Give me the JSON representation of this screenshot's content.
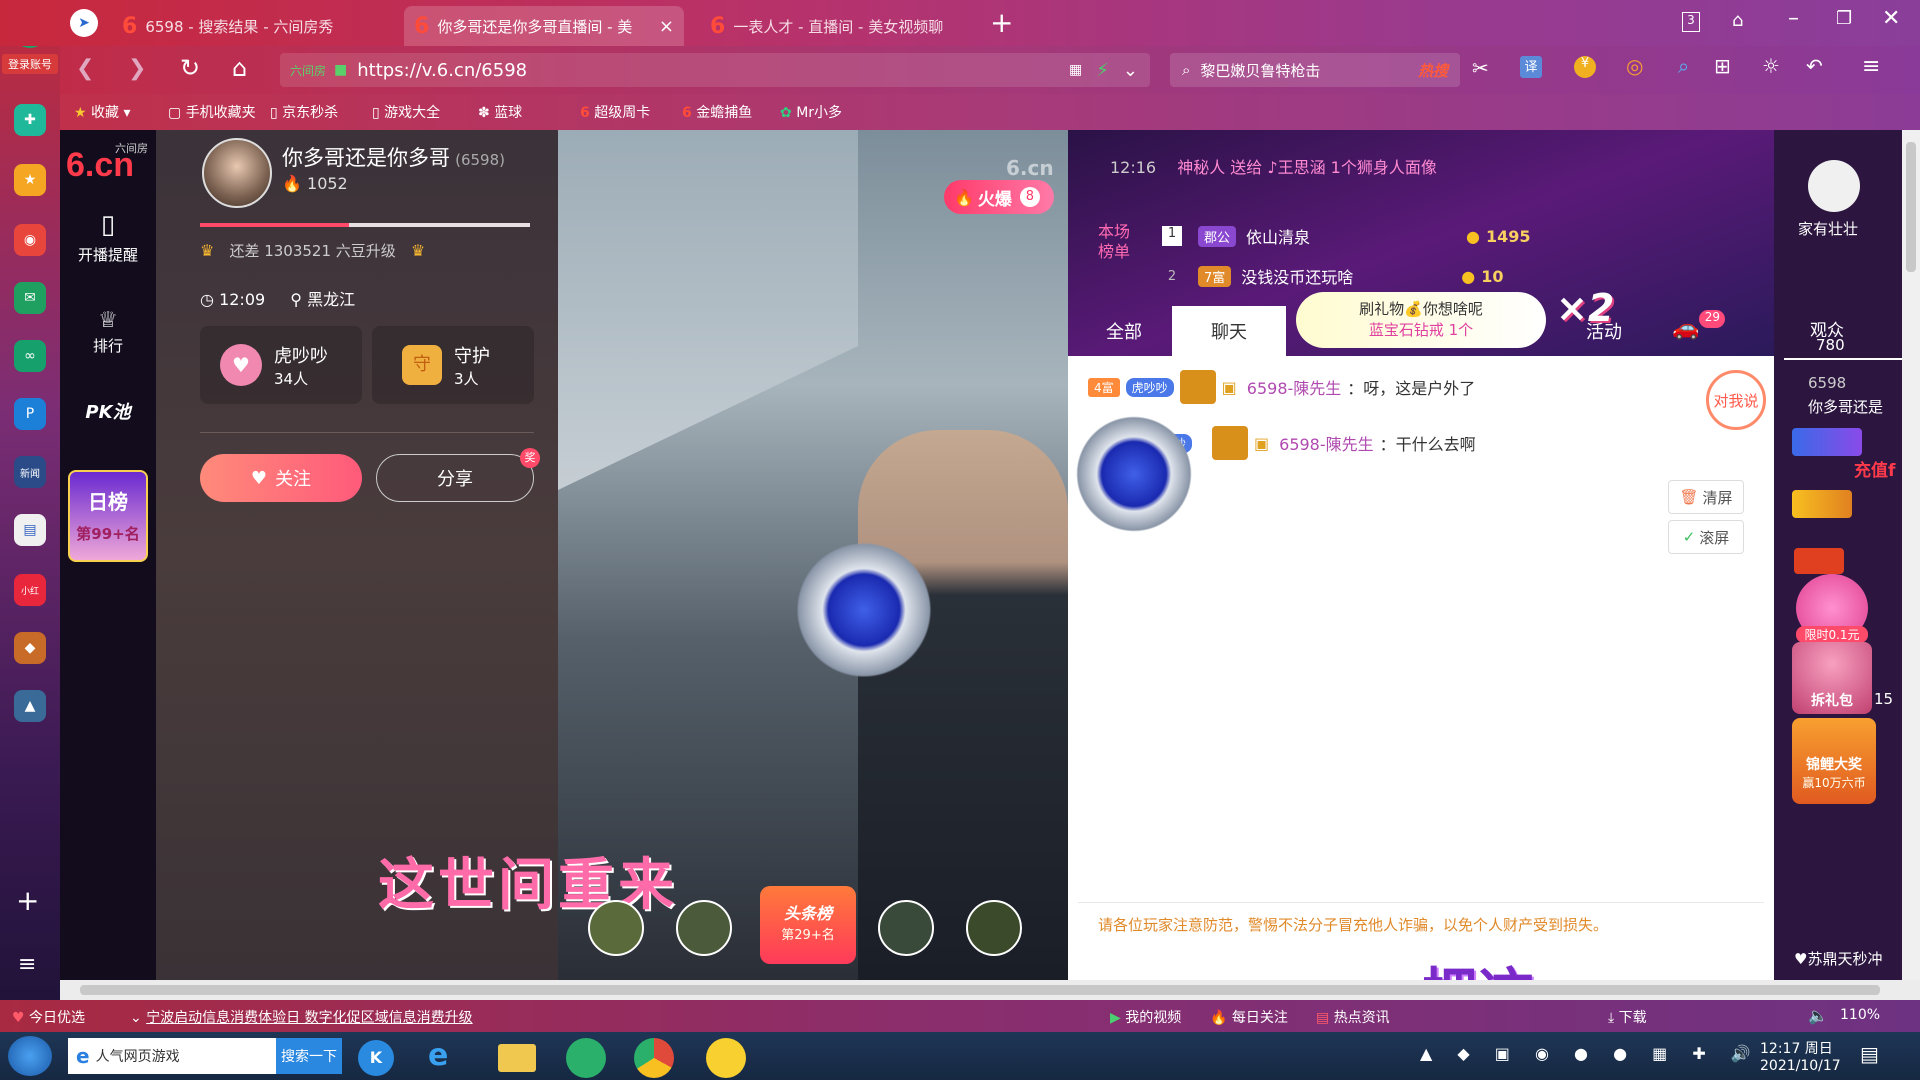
{
  "dock": {
    "login_label": "登录账号"
  },
  "tabs": [
    {
      "title": "6598 - 搜索结果 - 六间房秀"
    },
    {
      "title": "你多哥还是你多哥直播间 - 美",
      "close": "×"
    },
    {
      "title": "一表人才 - 直播间 - 美女视频聊"
    }
  ],
  "toolbar": {
    "new_tab": "+",
    "tab_count": "3",
    "address_badge": "六间房",
    "url": "https://v.6.cn/6598",
    "search_text": "黎巴嫩贝鲁特枪击",
    "search_hot": "热搜",
    "translate": "译"
  },
  "bookmarks": [
    "收藏",
    "手机收藏夹",
    "京东秒杀",
    "游戏大全",
    "蓝球",
    "超级周卡",
    "金蟾捕鱼",
    "Mr小多"
  ],
  "site_nav": {
    "logo_top": "六间房",
    "logo": "6.cn",
    "broadcast_remind": "开播提醒",
    "rank": "排行",
    "pk_pool": "PK池",
    "daily_rank_label": "日榜",
    "daily_rank_value": "第99+名"
  },
  "host": {
    "name": "你多哥还是你多哥",
    "room_id": "(6598)",
    "fans": "1052",
    "upgrade_text": "还差 1303521 六豆升级",
    "time": "12:09",
    "location": "黑龙江",
    "fan_group_name": "虎吵吵",
    "fan_group_count": "34人",
    "guard_name": "守护",
    "guard_count": "3人",
    "follow_label": "关注",
    "share_label": "分享",
    "progress_fraction": 0.45
  },
  "video": {
    "watermark": "6.cn",
    "hot_label": "火爆",
    "hot_count": "8",
    "subtitle": "这世间重来",
    "headline_badge": "头条榜",
    "headline_rank": "第29+名"
  },
  "gift_feed": [
    {
      "time": "12:16",
      "text": "神秘人 送给 ♪王思涵 1个狮身人面像"
    }
  ],
  "leaderboard": {
    "label": "本场榜单",
    "rows": [
      {
        "rank": "1",
        "badge": "郡公",
        "name": "依山清泉",
        "coins": "1495"
      },
      {
        "rank": "2",
        "badge": "7富",
        "name": "没钱没币还玩啥",
        "coins": "10"
      }
    ]
  },
  "promo": {
    "line1": "刷礼物💰你想啥呢",
    "line2": "蓝宝石钻戒 1个",
    "multiplier": "×2"
  },
  "chat_tabs": [
    "全部",
    "聊天",
    "活动"
  ],
  "chat_tab_badge": "29",
  "chat_messages": [
    {
      "badge": "4富",
      "fan_badge": "虎吵吵",
      "user": "6598-陳先生",
      "text": "：呀，这是户外了"
    },
    {
      "badge": "",
      "fan_badge": "吵",
      "user": "6598-陳先生",
      "text": "：干什么去啊"
    }
  ],
  "chat_actions": {
    "talk_to_me": "对我说",
    "clear": "清屏",
    "scroll": "滚屏"
  },
  "chat_notice": "请各位玩家注意防范，警惕不法分子冒充他人诈骗，以免个人财产受到损失。",
  "overlay_text": "把这",
  "right_panel": {
    "user_label": "家有壮壮",
    "audience_label": "观众",
    "audience_count": "780",
    "viewer_id": "6598",
    "viewer_name": "你多哥还是",
    "recharge_text": "充值f",
    "promo_limited": "限时0.1元",
    "gift_pack": "拆礼包",
    "gift_pack_count": "15",
    "lottery": "锦鲤大奖",
    "lottery_sub": "赢10万六币",
    "ticker": "♥苏鼎天秒冲"
  },
  "statusbar": {
    "today": "今日优选",
    "news": "宁波启动信息消费体验日 数字化促区域信息消费升级",
    "my_video": "我的视频",
    "daily_follow": "每日关注",
    "hot_news": "热点资讯",
    "download": "下载",
    "zoom": "110%"
  },
  "taskbar": {
    "ie_label": "人气网页游戏",
    "search_button": "搜索一下",
    "time": "12:17 周日",
    "date": "2021/10/17"
  }
}
